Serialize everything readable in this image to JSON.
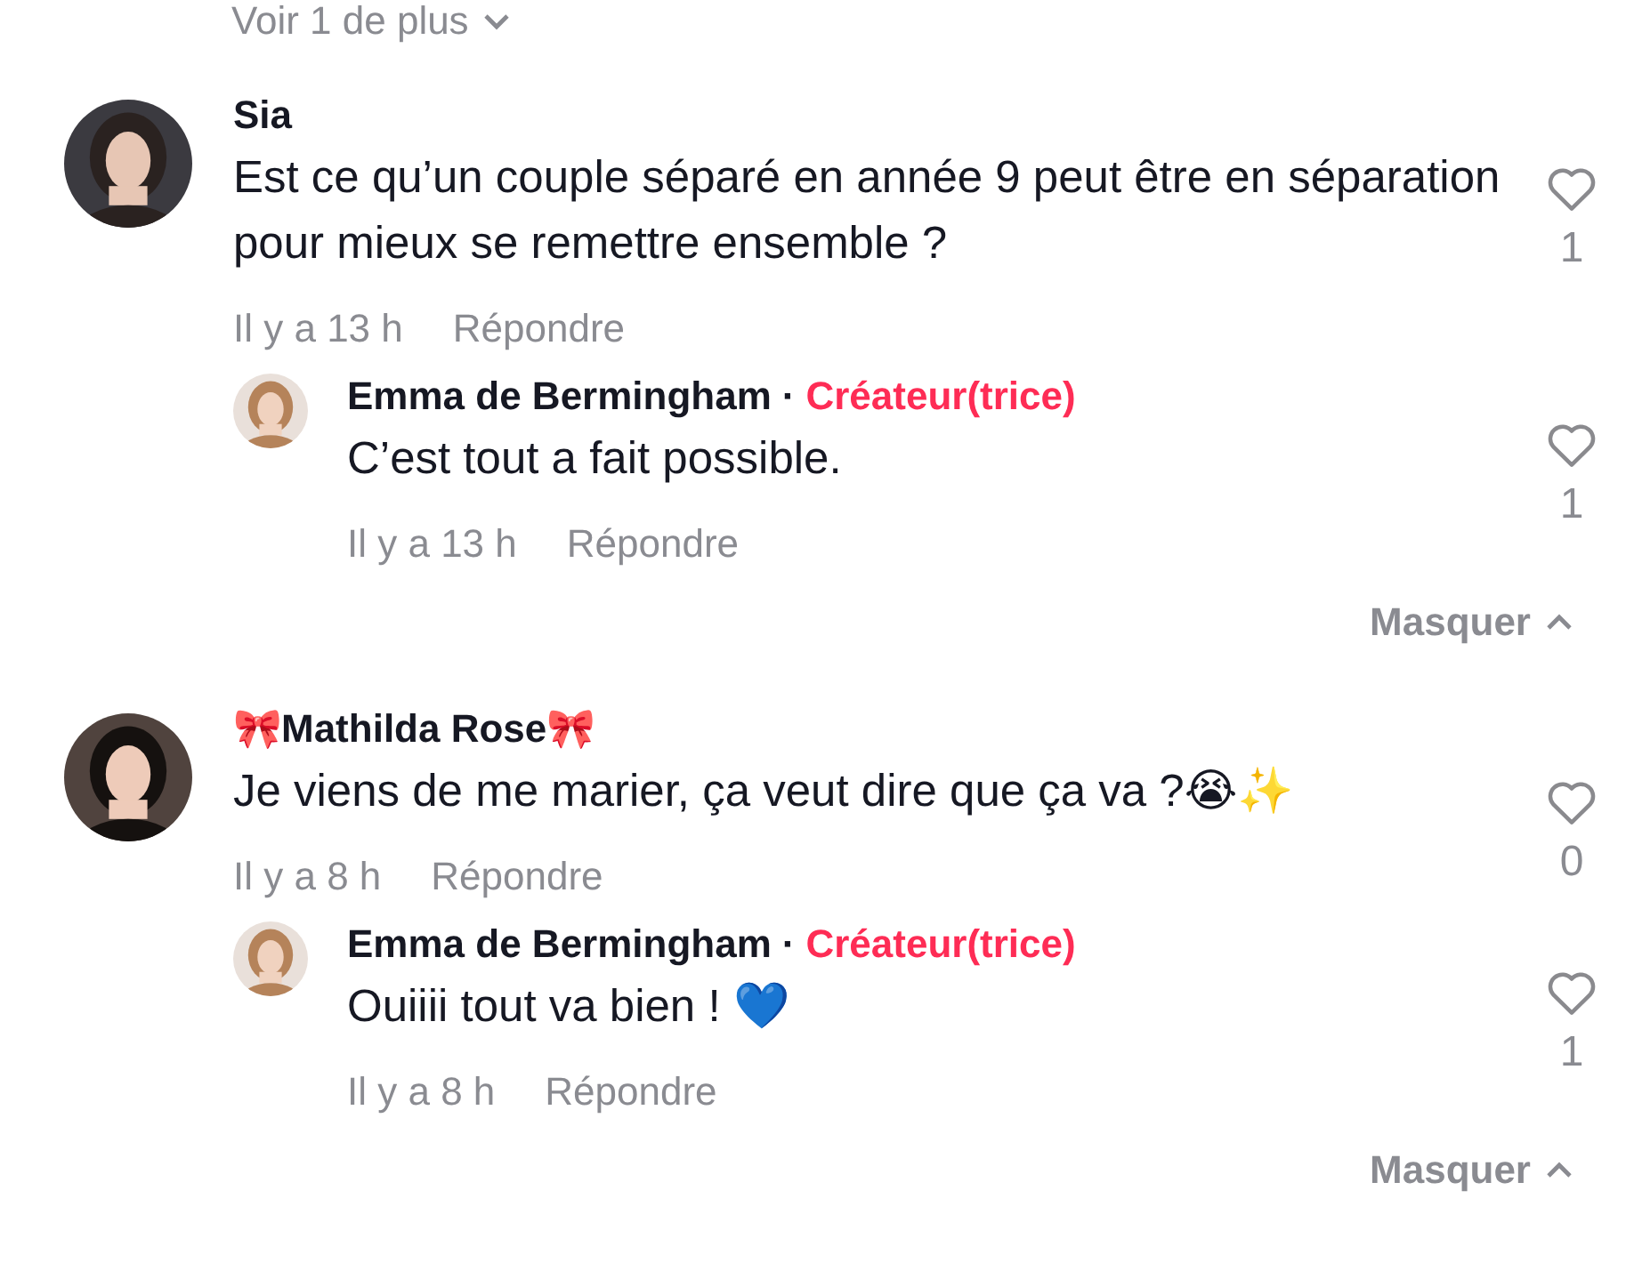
{
  "top_toggle": {
    "label": "Voir 1 de plus"
  },
  "comments": [
    {
      "author": "Sia",
      "text": "Est ce qu’un couple séparé en année 9 peut être en séparation pour mieux se remettre ensemble ?",
      "time": "Il y a 13 h",
      "reply_action": "Répondre",
      "likes": "1",
      "replies": [
        {
          "author": "Emma de Bermingham",
          "separator": "·",
          "badge": "Créateur(trice)",
          "text": "C’est tout a fait possible.",
          "time": "Il y a 13 h",
          "reply_action": "Répondre",
          "likes": "1"
        }
      ],
      "toggle": {
        "label": "Masquer"
      }
    },
    {
      "author": "🎀Mathilda Rose🎀",
      "text": "Je viens de me marier, ça veut dire que ça va ?😭✨",
      "time": "Il y a 8 h",
      "reply_action": "Répondre",
      "likes": "0",
      "replies": [
        {
          "author": "Emma de Bermingham",
          "separator": "·",
          "badge": "Créateur(trice)",
          "text": "Ouiiii tout va bien ! 💙",
          "time": "Il y a 8 h",
          "reply_action": "Répondre",
          "likes": "1"
        }
      ],
      "toggle": {
        "label": "Masquer"
      }
    }
  ]
}
